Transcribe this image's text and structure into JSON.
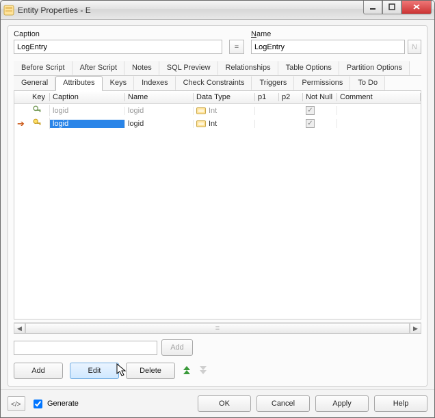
{
  "window": {
    "title": "Entity Properties - E"
  },
  "fields": {
    "caption_label_pre": "C",
    "caption_label_rest": "aption",
    "caption_value": "LogEntry",
    "eq_button": "=",
    "name_label_pre": "N",
    "name_label_rest": "ame",
    "name_value": "LogEntry",
    "name_side_button": "N"
  },
  "tabs_row1": [
    "Before Script",
    "After Script",
    "Notes",
    "SQL Preview",
    "Relationships",
    "Table Options",
    "Partition Options"
  ],
  "tabs_row2": [
    "General",
    "Attributes",
    "Keys",
    "Indexes",
    "Check Constraints",
    "Triggers",
    "Permissions",
    "To Do"
  ],
  "active_tab": "Attributes",
  "grid": {
    "headers": {
      "arrow": "",
      "key": "Key",
      "caption": "Caption",
      "name": "Name",
      "datatype": "Data Type",
      "p1": "p1",
      "p2": "p2",
      "notnull": "Not Null",
      "comment": "Comment"
    },
    "rows": [
      {
        "selected": false,
        "key_icon": "pk",
        "caption": "logid",
        "name": "logid",
        "datatype": "Int",
        "p1": "",
        "p2": "",
        "notnull": true,
        "comment": ""
      },
      {
        "selected": true,
        "key_icon": "key",
        "caption": "logid",
        "name": "logid",
        "datatype": "Int",
        "p1": "",
        "p2": "",
        "notnull": true,
        "comment": ""
      }
    ]
  },
  "quick_add": {
    "value": "",
    "button": "Add"
  },
  "action_buttons": {
    "add": "Add",
    "edit": "Edit",
    "delete": "Delete"
  },
  "move": {
    "up_title": "Move Up",
    "down_title": "Move Down"
  },
  "footer": {
    "code_button": "‹/›",
    "generate_label": "Generate",
    "generate_checked": true,
    "ok": "OK",
    "cancel": "Cancel",
    "apply": "Apply",
    "help": "Help"
  }
}
